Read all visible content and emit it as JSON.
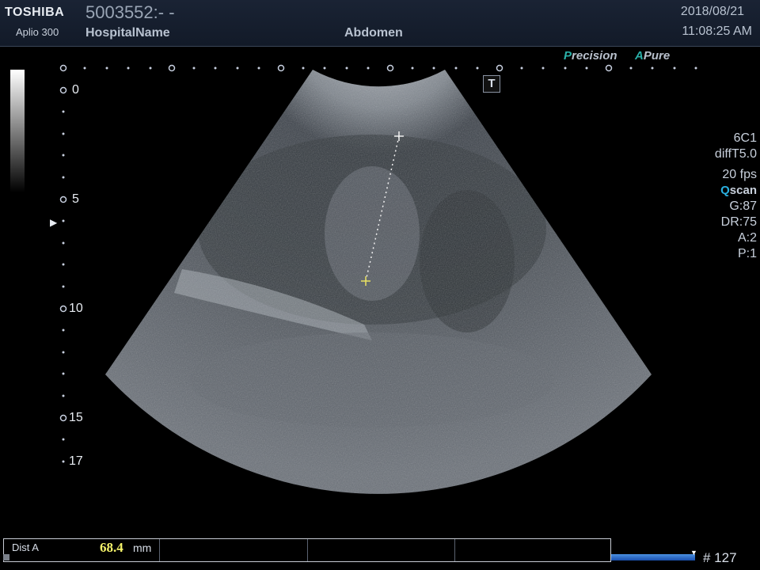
{
  "header": {
    "brand": "TOSHIBA",
    "model": "Aplio 300",
    "patient_id": "5003552:- -",
    "hospital": "HospitalName",
    "exam": "Abdomen",
    "date": "2018/08/21",
    "time": "11:08:25 AM"
  },
  "badges": {
    "precision_accent": "P",
    "precision_rest": "recision",
    "apure_accent": "A",
    "apure_rest": "Pure"
  },
  "t_marker": "T",
  "params": {
    "probe": "6C1",
    "mode": "diffT5.0",
    "fps": "20 fps",
    "qscan_q": "Q",
    "qscan_rest": "scan",
    "gain": "G:87",
    "dr": "DR:75",
    "a": "A:2",
    "p": "P:1"
  },
  "depth_labels": [
    "0",
    "5",
    "10",
    "15",
    "17"
  ],
  "measurement": {
    "label": "Dist A",
    "value": "68.4",
    "unit": "mm"
  },
  "frame": "# 127",
  "colors": {
    "accent": "#2ab0a8",
    "measurement_value": "#f4f26a",
    "caliper": "#e8e060"
  }
}
